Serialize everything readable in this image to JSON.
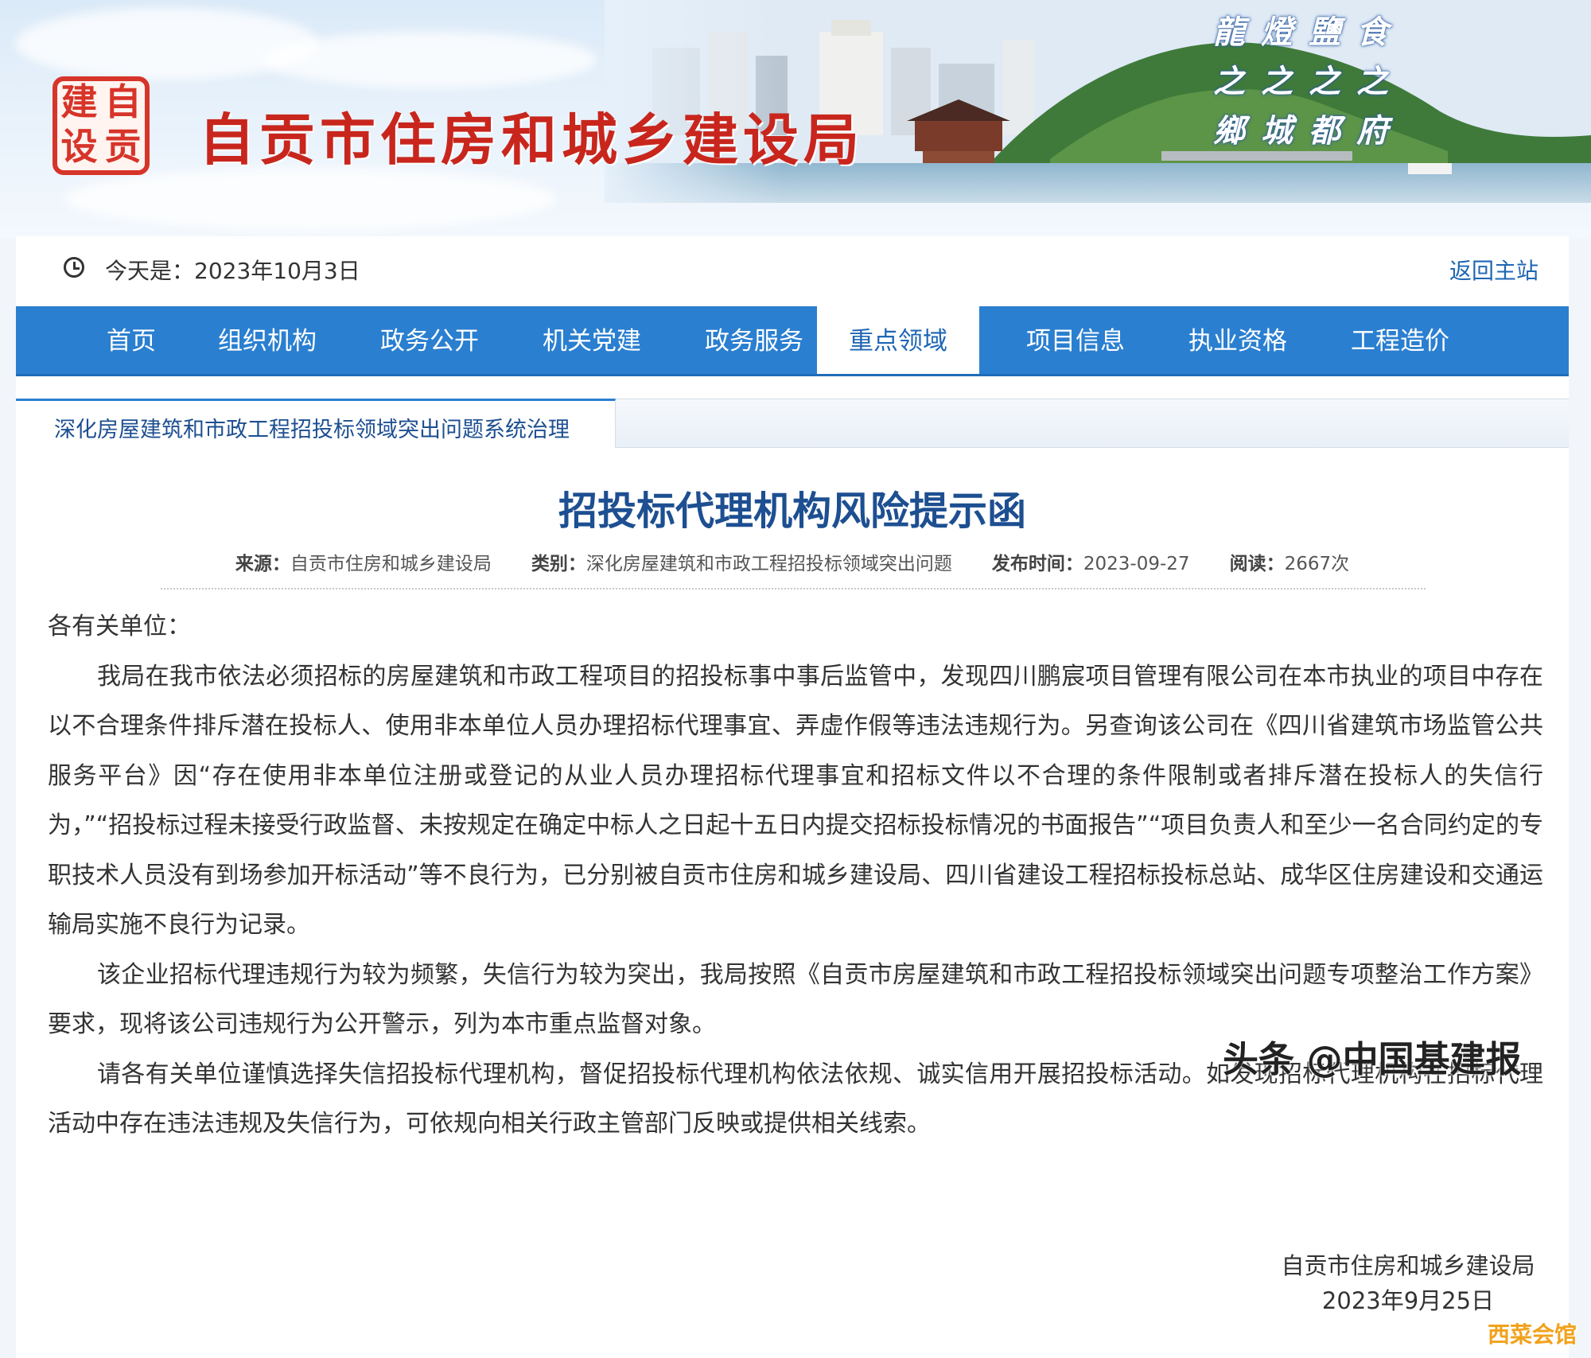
{
  "header": {
    "logo_chars": [
      "建",
      "自",
      "设",
      "贡"
    ],
    "site_title": "自贡市住房和城乡建设局",
    "motto": [
      "龍",
      "燈",
      "鹽",
      "食",
      "之",
      "之",
      "之",
      "之",
      "鄉",
      "城",
      "都",
      "府"
    ]
  },
  "topbar": {
    "date_label": "今天是：2023年10月3日",
    "home_link": "返回主站"
  },
  "nav": {
    "items": [
      "首页",
      "组织机构",
      "政务公开",
      "机关党建",
      "政务服务",
      "重点领域",
      "项目信息",
      "执业资格",
      "工程造价"
    ],
    "active": "重点领域"
  },
  "subtab": {
    "label": "深化房屋建筑和市政工程招投标领域突出问题系统治理"
  },
  "article": {
    "title": "招投标代理机构风险提示函",
    "meta": {
      "source_key": "来源：",
      "source_val": "自贡市住房和城乡建设局",
      "category_key": "类别：",
      "category_val": "深化房屋建筑和市政工程招投标领域突出问题",
      "time_key": "发布时间：",
      "time_val": "2023-09-27",
      "views_key": "阅读：",
      "views_val": "2667次"
    },
    "salutation": "各有关单位：",
    "paragraphs": [
      "我局在我市依法必须招标的房屋建筑和市政工程项目的招投标事中事后监管中，发现四川鹏宸项目管理有限公司在本市执业的项目中存在以不合理条件排斥潜在投标人、使用非本单位人员办理招标代理事宜、弄虚作假等违法违规行为。另查询该公司在《四川省建筑市场监管公共服务平台》因“存在使用非本单位注册或登记的从业人员办理招标代理事宜和招标文件以不合理的条件限制或者排斥潜在投标人的失信行为，”“招投标过程未接受行政监督、未按规定在确定中标人之日起十五日内提交招标投标情况的书面报告”“项目负责人和至少一名合同约定的专职技术人员没有到场参加开标活动”等不良行为，已分别被自贡市住房和城乡建设局、四川省建设工程招标投标总站、成华区住房建设和交通运输局实施不良行为记录。",
      "该企业招标代理违规行为较为频繁，失信行为较为突出，我局按照《自贡市房屋建筑和市政工程招投标领域突出问题专项整治工作方案》要求，现将该公司违规行为公开警示，列为本市重点监督对象。",
      "请各有关单位谨慎选择失信招投标代理机构，督促招投标代理机构依法依规、诚实信用开展招投标活动。如发现招标代理机构在招标代理活动中存在违法违规及失信行为，可依规向相关行政主管部门反映或提供相关线索。"
    ],
    "signature_org": "自贡市住房和城乡建设局",
    "signature_date": "2023年9月25日"
  },
  "overlays": {
    "watermark": "头条 @中国基建报",
    "corner_mark": "西菜会馆"
  }
}
